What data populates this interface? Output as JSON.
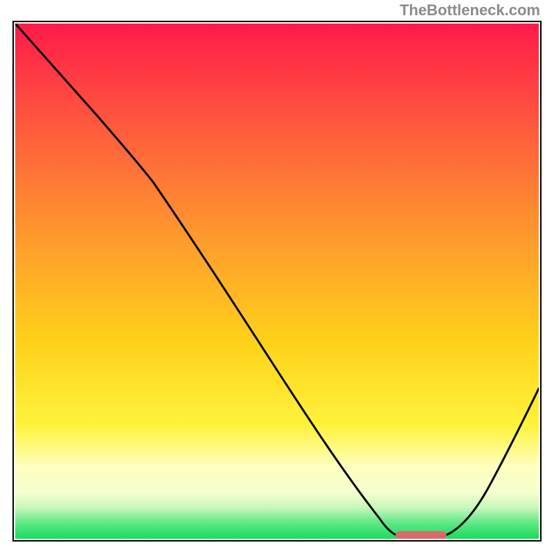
{
  "watermark": {
    "text": "TheBottleneck.com"
  },
  "chart_data": {
    "type": "line",
    "title": "",
    "xlabel": "",
    "ylabel": "",
    "xlim": [
      0,
      1
    ],
    "ylim": [
      0,
      1
    ],
    "grid": false,
    "legend": false,
    "curve": {
      "name": "curve",
      "x": [
        0.0,
        0.06,
        0.12,
        0.18,
        0.24,
        0.3,
        0.36,
        0.42,
        0.48,
        0.54,
        0.6,
        0.66,
        0.72,
        0.77,
        0.82,
        0.87,
        0.92,
        0.96,
        1.0
      ],
      "y": [
        1.0,
        0.94,
        0.87,
        0.8,
        0.73,
        0.64,
        0.55,
        0.46,
        0.37,
        0.28,
        0.19,
        0.1,
        0.02,
        0.0,
        0.0,
        0.05,
        0.12,
        0.2,
        0.28
      ]
    },
    "flat_segment": {
      "x_start": 0.72,
      "x_end": 0.82,
      "y": 0.0
    },
    "marker": {
      "x": 0.775,
      "y": 0.005,
      "color": "#d86a6a"
    },
    "background_gradient": {
      "top_color": "#ff1a4a",
      "mid_color": "#ffd21a",
      "pale_yellow": "#ffffbe",
      "green": "#1adc5b",
      "stops_pct": [
        0,
        35,
        76,
        88,
        95,
        100
      ]
    }
  }
}
